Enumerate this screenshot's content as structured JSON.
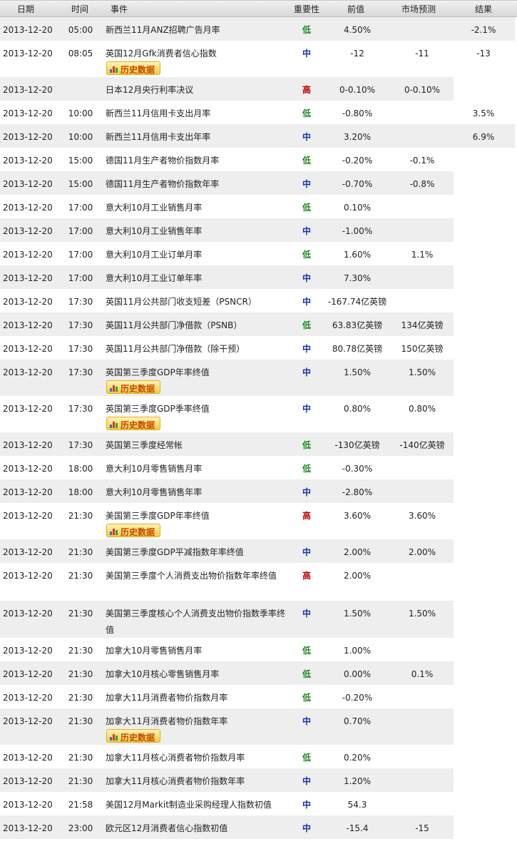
{
  "headers": {
    "date": "日期",
    "time": "时间",
    "event": "事件",
    "importance": "重要性",
    "previous": "前值",
    "forecast": "市场预测",
    "result": "结果"
  },
  "history_button_label": "历史数据",
  "colors": {
    "shaded_row": "#eeeeee",
    "importance_low": "#1a8a1a",
    "importance_mid": "#1030b0",
    "importance_high": "#c00000"
  },
  "rows": [
    {
      "date": "2013-12-20",
      "time": "05:00",
      "event": "新西兰11月ANZ招聘广告月率",
      "importance": "低",
      "previous": "4.50%",
      "forecast": "",
      "result": "-2.1%",
      "history": false,
      "h": 33,
      "shaded": true,
      "res_shade": true
    },
    {
      "date": "2013-12-20",
      "time": "08:05",
      "event": "英国12月Gfk消费者信心指数",
      "importance": "中",
      "previous": "-12",
      "forecast": "-11",
      "result": "-13",
      "history": true,
      "h": 51,
      "shaded": false,
      "res_shade": false
    },
    {
      "date": "2013-12-20",
      "time": "",
      "event": "日本12月央行利率决议",
      "importance": "高",
      "previous": "0-0.10%",
      "forecast": "0-0.10%",
      "result": "",
      "history": false,
      "h": 33,
      "shaded": true,
      "res_shade": false
    },
    {
      "date": "2013-12-20",
      "time": "10:00",
      "event": "新西兰11月信用卡支出月率",
      "importance": "低",
      "previous": "-0.80%",
      "forecast": "",
      "result": "3.5%",
      "history": false,
      "h": 33,
      "shaded": false,
      "res_shade": false
    },
    {
      "date": "2013-12-20",
      "time": "10:00",
      "event": "新西兰11月信用卡支出年率",
      "importance": "中",
      "previous": "3.20%",
      "forecast": "",
      "result": "6.9%",
      "history": false,
      "h": 33,
      "shaded": true,
      "res_shade": true
    },
    {
      "date": "2013-12-20",
      "time": "15:00",
      "event": "德国11月生产者物价指数月率",
      "importance": "低",
      "previous": "-0.20%",
      "forecast": "-0.1%",
      "result": "",
      "history": false,
      "h": 33,
      "shaded": false,
      "res_shade": false
    },
    {
      "date": "2013-12-20",
      "time": "15:00",
      "event": "德国11月生产者物价指数年率",
      "importance": "中",
      "previous": "-0.70%",
      "forecast": "-0.8%",
      "result": "",
      "history": false,
      "h": 33,
      "shaded": true,
      "res_shade": false
    },
    {
      "date": "2013-12-20",
      "time": "17:00",
      "event": "意大利10月工业销售月率",
      "importance": "低",
      "previous": "0.10%",
      "forecast": "",
      "result": "",
      "history": false,
      "h": 33,
      "shaded": false,
      "res_shade": false
    },
    {
      "date": "2013-12-20",
      "time": "17:00",
      "event": "意大利10月工业销售年率",
      "importance": "中",
      "previous": "-1.00%",
      "forecast": "",
      "result": "",
      "history": false,
      "h": 33,
      "shaded": true,
      "res_shade": false
    },
    {
      "date": "2013-12-20",
      "time": "17:00",
      "event": "意大利10月工业订单月率",
      "importance": "低",
      "previous": "1.60%",
      "forecast": "1.1%",
      "result": "",
      "history": false,
      "h": 33,
      "shaded": false,
      "res_shade": false
    },
    {
      "date": "2013-12-20",
      "time": "17:00",
      "event": "意大利10月工业订单年率",
      "importance": "中",
      "previous": "7.30%",
      "forecast": "",
      "result": "",
      "history": false,
      "h": 33,
      "shaded": true,
      "res_shade": false
    },
    {
      "date": "2013-12-20",
      "time": "17:30",
      "event": "英国11月公共部门收支短差（PSNCR）",
      "importance": "中",
      "previous": "-167.74亿英镑",
      "forecast": "",
      "result": "",
      "history": false,
      "h": 33,
      "shaded": false,
      "res_shade": false
    },
    {
      "date": "2013-12-20",
      "time": "17:30",
      "event": "英国11月公共部门净借款（PSNB）",
      "importance": "低",
      "previous": "63.83亿英镑",
      "forecast": "134亿英镑",
      "result": "",
      "history": false,
      "h": 33,
      "shaded": true,
      "res_shade": false
    },
    {
      "date": "2013-12-20",
      "time": "17:30",
      "event": "英国11月公共部门净借款（除干预）",
      "importance": "中",
      "previous": "80.78亿英镑",
      "forecast": "150亿英镑",
      "result": "",
      "history": false,
      "h": 33,
      "shaded": false,
      "res_shade": false
    },
    {
      "date": "2013-12-20",
      "time": "17:30",
      "event": "英国第三季度GDP年率终值",
      "importance": "中",
      "previous": "1.50%",
      "forecast": "1.50%",
      "result": "",
      "history": true,
      "h": 51,
      "shaded": true,
      "res_shade": false
    },
    {
      "date": "2013-12-20",
      "time": "17:30",
      "event": "英国第三季度GDP季率终值",
      "importance": "中",
      "previous": "0.80%",
      "forecast": "0.80%",
      "result": "",
      "history": true,
      "h": 51,
      "shaded": false,
      "res_shade": false
    },
    {
      "date": "2013-12-20",
      "time": "17:30",
      "event": "英国第三季度经常帐",
      "importance": "低",
      "previous": "-130亿英镑",
      "forecast": "-140亿英镑",
      "result": "",
      "history": false,
      "h": 33,
      "shaded": true,
      "res_shade": false
    },
    {
      "date": "2013-12-20",
      "time": "18:00",
      "event": "意大利10月零售销售月率",
      "importance": "低",
      "previous": "-0.30%",
      "forecast": "",
      "result": "",
      "history": false,
      "h": 33,
      "shaded": false,
      "res_shade": false
    },
    {
      "date": "2013-12-20",
      "time": "18:00",
      "event": "意大利10月零售销售年率",
      "importance": "中",
      "previous": "-2.80%",
      "forecast": "",
      "result": "",
      "history": false,
      "h": 33,
      "shaded": true,
      "res_shade": false
    },
    {
      "date": "2013-12-20",
      "time": "21:30",
      "event": "美国第三季度GDP年率终值",
      "importance": "高",
      "previous": "3.60%",
      "forecast": "3.60%",
      "result": "",
      "history": true,
      "h": 51,
      "shaded": false,
      "res_shade": false
    },
    {
      "date": "2013-12-20",
      "time": "21:30",
      "event": "美国第三季度GDP平减指数年率终值",
      "importance": "中",
      "previous": "2.00%",
      "forecast": "2.00%",
      "result": "",
      "history": false,
      "h": 33,
      "shaded": true,
      "res_shade": false
    },
    {
      "date": "2013-12-20",
      "time": "21:30",
      "event": "美国第三季度个人消费支出物价指数年率终值",
      "importance": "高",
      "previous": "2.00%",
      "forecast": "",
      "result": "",
      "history": false,
      "h": 53,
      "shaded": false,
      "res_shade": false
    },
    {
      "date": "2013-12-20",
      "time": "21:30",
      "event": "美国第三季度核心个人消费支出物价指数季率终值",
      "importance": "中",
      "previous": "1.50%",
      "forecast": "1.50%",
      "result": "",
      "history": false,
      "h": 52,
      "shaded": true,
      "res_shade": false
    },
    {
      "date": "2013-12-20",
      "time": "21:30",
      "event": "加拿大10月零售销售月率",
      "importance": "低",
      "previous": "1.00%",
      "forecast": "",
      "result": "",
      "history": false,
      "h": 33,
      "shaded": false,
      "res_shade": false
    },
    {
      "date": "2013-12-20",
      "time": "21:30",
      "event": "加拿大10月核心零售销售月率",
      "importance": "低",
      "previous": "0.00%",
      "forecast": "0.1%",
      "result": "",
      "history": false,
      "h": 33,
      "shaded": true,
      "res_shade": false
    },
    {
      "date": "2013-12-20",
      "time": "21:30",
      "event": "加拿大11月消费者物价指数月率",
      "importance": "低",
      "previous": "-0.20%",
      "forecast": "",
      "result": "",
      "history": false,
      "h": 33,
      "shaded": false,
      "res_shade": false
    },
    {
      "date": "2013-12-20",
      "time": "21:30",
      "event": "加拿大11月消费者物价指数年率",
      "importance": "中",
      "previous": "0.70%",
      "forecast": "",
      "result": "",
      "history": true,
      "h": 51,
      "shaded": true,
      "res_shade": false
    },
    {
      "date": "2013-12-20",
      "time": "21:30",
      "event": "加拿大11月核心消费者物价指数月率",
      "importance": "低",
      "previous": "0.20%",
      "forecast": "",
      "result": "",
      "history": false,
      "h": 33,
      "shaded": false,
      "res_shade": false
    },
    {
      "date": "2013-12-20",
      "time": "21:30",
      "event": "加拿大11月核心消费者物价指数年率",
      "importance": "中",
      "previous": "1.20%",
      "forecast": "",
      "result": "",
      "history": false,
      "h": 33,
      "shaded": true,
      "res_shade": false
    },
    {
      "date": "2013-12-20",
      "time": "21:58",
      "event": "美国12月Markit制造业采购经理人指数初值",
      "importance": "中",
      "previous": "54.3",
      "forecast": "",
      "result": "",
      "history": false,
      "h": 33,
      "shaded": false,
      "res_shade": false
    },
    {
      "date": "2013-12-20",
      "time": "23:00",
      "event": "欧元区12月消费者信心指数初值",
      "importance": "中",
      "previous": "-15.4",
      "forecast": "-15",
      "result": "",
      "history": false,
      "h": 33,
      "shaded": true,
      "res_shade": false
    }
  ]
}
